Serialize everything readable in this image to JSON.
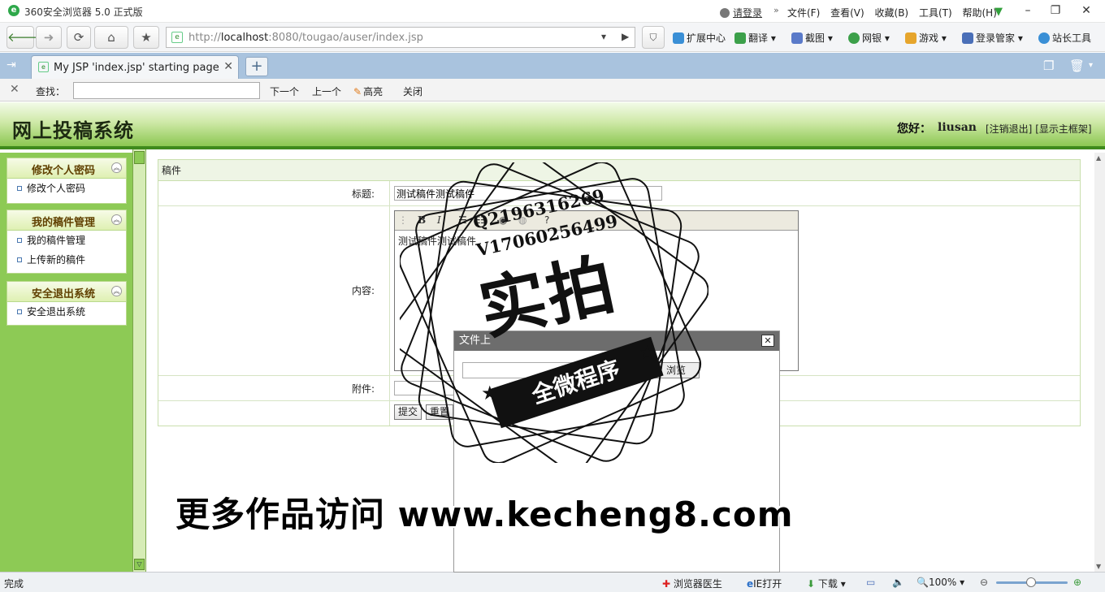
{
  "browser": {
    "app_title": "360安全浏览器 5.0 正式版",
    "login": "请登录",
    "menu": [
      "文件(F)",
      "查看(V)",
      "收藏(B)",
      "工具(T)",
      "帮助(H)"
    ],
    "url_prefix": "http://",
    "url_host": "localhost",
    "url_rest": ":8080/tougao/auser/index.jsp",
    "extensions": [
      "扩展中心",
      "翻译",
      "截图",
      "网银",
      "游戏",
      "登录管家",
      "站长工具"
    ],
    "tab_title": "My JSP 'index.jsp' starting page",
    "find": {
      "label": "查找：",
      "value": "",
      "next": "下一个",
      "prev": "上一个",
      "highlight": "高亮",
      "close": "关闭"
    },
    "status": {
      "text": "完成",
      "doctor": "浏览器医生",
      "ie_open": "IE打开",
      "download": "下载",
      "zoom": "100%"
    }
  },
  "app": {
    "system_title": "网上投稿系统",
    "greeting": "您好：",
    "username": "liusan",
    "logout_link": "[注销退出]",
    "frame_link": "[显示主框架]",
    "sidebar": [
      {
        "title": "修改个人密码",
        "items": [
          "修改个人密码"
        ]
      },
      {
        "title": "我的稿件管理",
        "items": [
          "我的稿件管理",
          "上传新的稿件"
        ]
      },
      {
        "title": "安全退出系统",
        "items": [
          "安全退出系统"
        ]
      }
    ],
    "form": {
      "caption": "稿件",
      "title_label": "标题:",
      "title_value": "测试稿件测试稿件",
      "content_label": "内容:",
      "content_value": "测试稿件测试稿件",
      "attachment_label": "附件:",
      "submit": "提交",
      "reset": "重置"
    },
    "dialog": {
      "title": "文件上",
      "browse": "浏览"
    }
  },
  "watermark": {
    "qq": "Q2196316269",
    "v": "V17060256499",
    "main": "实拍",
    "ribbon": "全微程序",
    "site": "更多作品访问 www.kecheng8.com"
  }
}
